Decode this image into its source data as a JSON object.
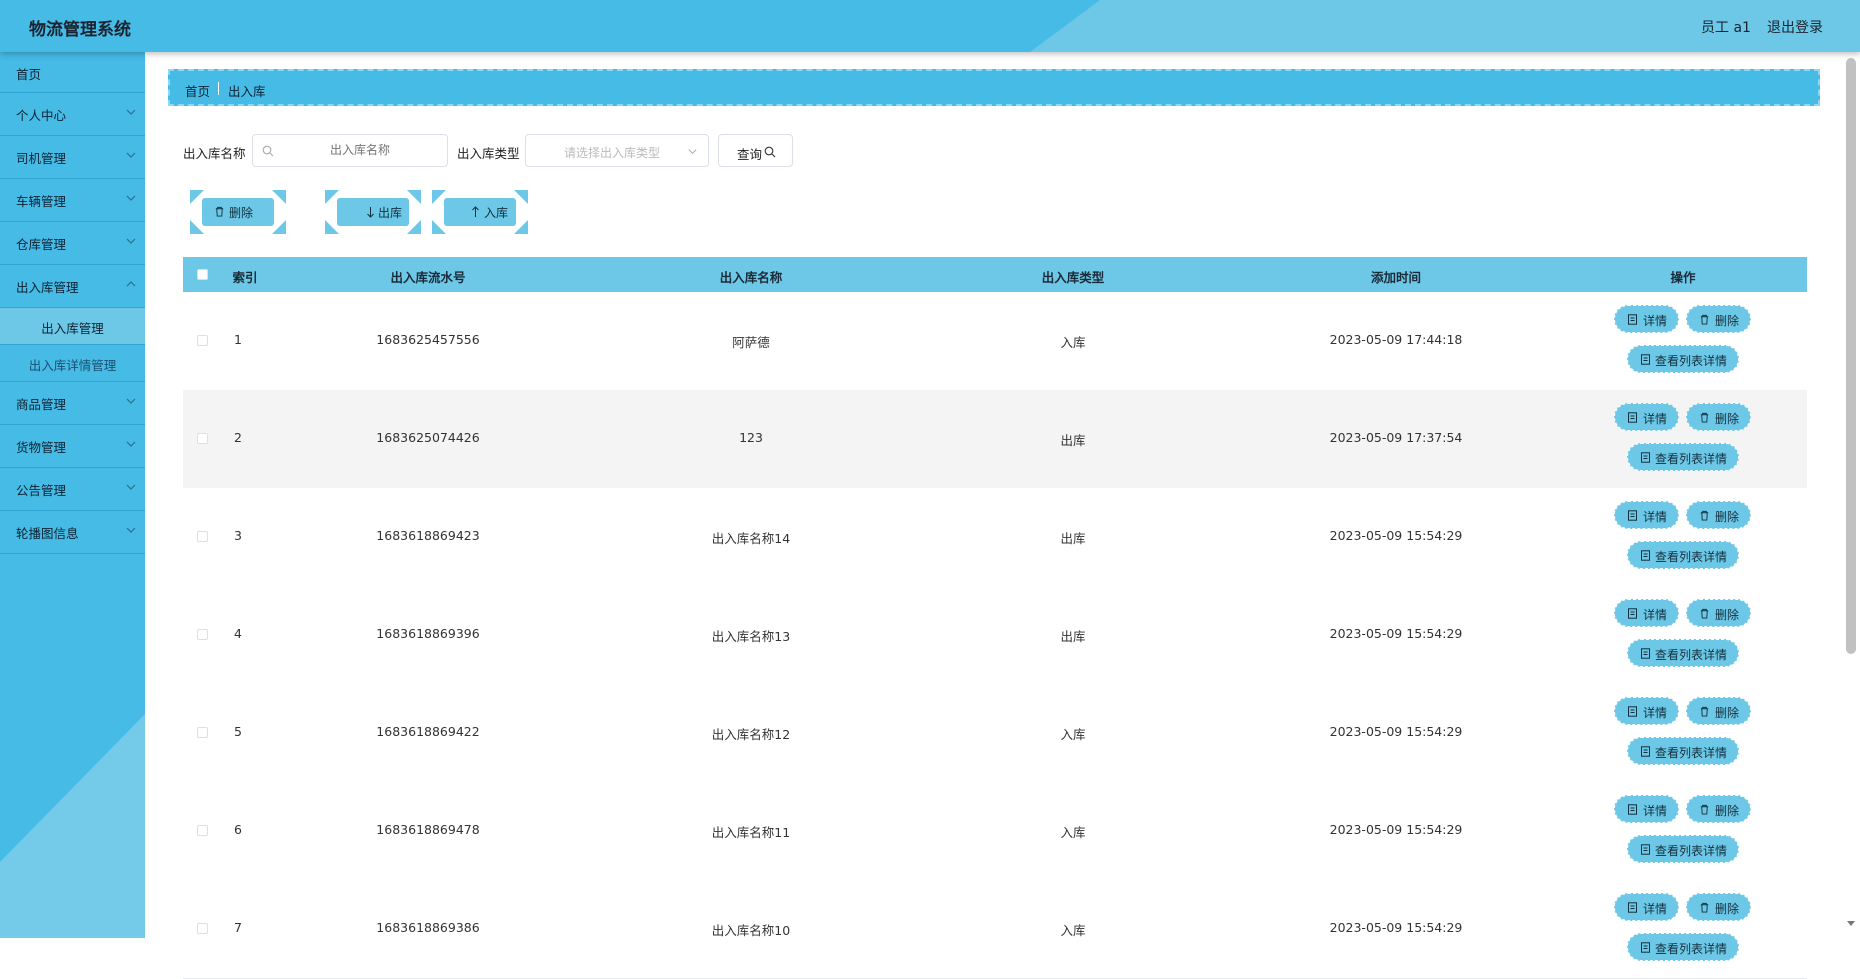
{
  "header": {
    "title": "物流管理系统",
    "user": "员工 a1",
    "logout": "退出登录"
  },
  "sidebar": {
    "items": [
      {
        "label": "首页"
      },
      {
        "label": "个人中心"
      },
      {
        "label": "司机管理"
      },
      {
        "label": "车辆管理"
      },
      {
        "label": "仓库管理"
      },
      {
        "label": "出入库管理"
      },
      {
        "label": "商品管理"
      },
      {
        "label": "货物管理"
      },
      {
        "label": "公告管理"
      },
      {
        "label": "轮播图信息"
      }
    ],
    "subitems": [
      {
        "label": "出入库管理"
      },
      {
        "label": "出入库详情管理"
      }
    ]
  },
  "breadcrumb": {
    "home": "首页",
    "current": "出入库"
  },
  "search": {
    "name_label": "出入库名称",
    "name_placeholder": "出入库名称",
    "type_label": "出入库类型",
    "type_placeholder": "请选择出入库类型",
    "query_label": "查询"
  },
  "actions": {
    "delete": "删除",
    "out": "出库",
    "in": "入库"
  },
  "table": {
    "headers": [
      "索引",
      "出入库流水号",
      "出入库名称",
      "出入库类型",
      "添加时间",
      "操作"
    ],
    "row_buttons": {
      "detail": "详情",
      "delete": "删除",
      "list_detail": "查看列表详情"
    },
    "rows": [
      {
        "index": "1",
        "serial": "1683625457556",
        "name": "阿萨德",
        "type": "入库",
        "time": "2023-05-09 17:44:18"
      },
      {
        "index": "2",
        "serial": "1683625074426",
        "name": "123",
        "type": "出库",
        "time": "2023-05-09 17:37:54"
      },
      {
        "index": "3",
        "serial": "1683618869423",
        "name": "出入库名称14",
        "type": "出库",
        "time": "2023-05-09 15:54:29"
      },
      {
        "index": "4",
        "serial": "1683618869396",
        "name": "出入库名称13",
        "type": "出库",
        "time": "2023-05-09 15:54:29"
      },
      {
        "index": "5",
        "serial": "1683618869422",
        "name": "出入库名称12",
        "type": "入库",
        "time": "2023-05-09 15:54:29"
      },
      {
        "index": "6",
        "serial": "1683618869478",
        "name": "出入库名称11",
        "type": "入库",
        "time": "2023-05-09 15:54:29"
      },
      {
        "index": "7",
        "serial": "1683618869386",
        "name": "出入库名称10",
        "type": "入库",
        "time": "2023-05-09 15:54:29"
      }
    ]
  },
  "colors": {
    "primary": "#45bbe6",
    "light": "#6cc8e6",
    "border": "#2ea7d4"
  }
}
